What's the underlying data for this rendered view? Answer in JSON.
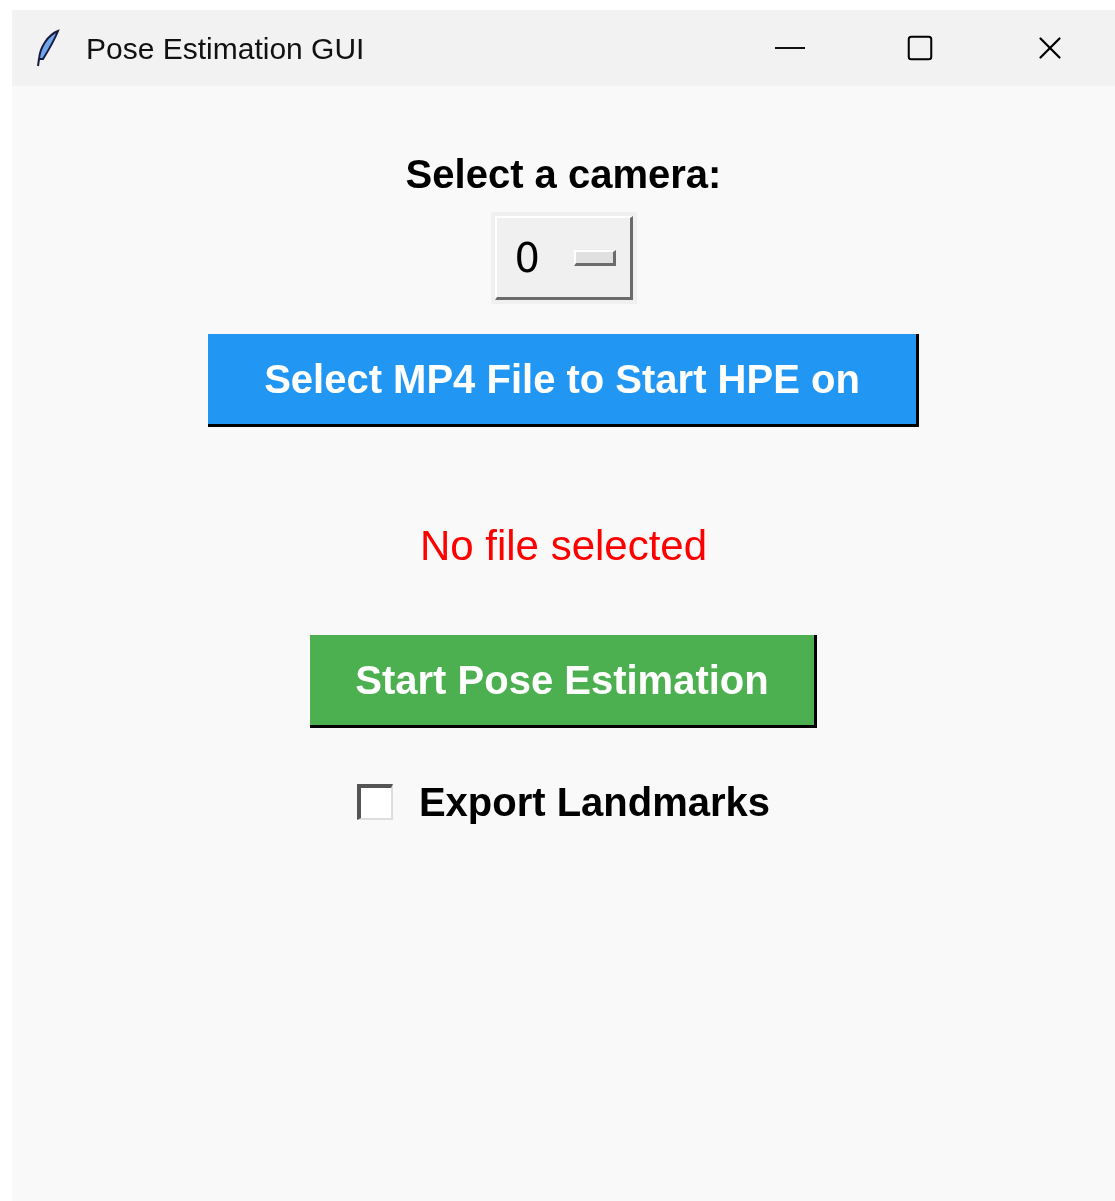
{
  "window": {
    "title": "Pose Estimation GUI"
  },
  "camera": {
    "label": "Select a camera:",
    "value": "0"
  },
  "select_file_button": "Select MP4 File to Start HPE on",
  "file_status": "No file selected",
  "start_button": "Start Pose Estimation",
  "export_landmarks": {
    "label": "Export Landmarks",
    "checked": false
  }
}
